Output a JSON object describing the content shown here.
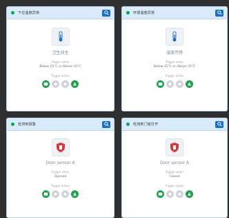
{
  "cards": [
    {
      "title": "下位温度异常",
      "device": "卫生间主",
      "trigger_label": "Trigger when",
      "trigger_value": "Below 15°C or Above 35°C",
      "action_label": "Trigger action"
    },
    {
      "title": "环境温度异常",
      "device": "温度传感",
      "trigger_label": "Trigger when",
      "trigger_value": "Below 15°C or Above 35°C",
      "action_label": "Trigger action"
    },
    {
      "title": "检测到报警",
      "device": "Door sensor A",
      "trigger_label": "Trigger when",
      "trigger_value": "Opened",
      "action_label": "Trigger action"
    },
    {
      "title": "检测到门窗打开",
      "device": "Door sensor A",
      "trigger_label": "Trigger when",
      "trigger_value": "Closed",
      "action_label": "Trigger action"
    }
  ],
  "colors": {
    "accent": "#1b6fc4",
    "status": "#11a34a",
    "alarm": "#d63a3a"
  },
  "icons": {
    "header_action": "search-icon",
    "temperature_device": "thermometer-icon",
    "door_device": "shield-icon",
    "actions": [
      "message-icon",
      "gear-icon",
      "toggle-icon",
      "bell-icon"
    ]
  }
}
